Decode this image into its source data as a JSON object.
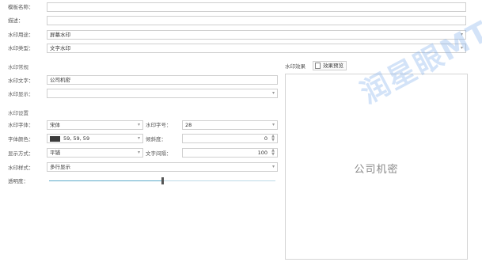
{
  "form": {
    "template_name": {
      "label": "模板名称：",
      "value": ""
    },
    "description": {
      "label": "描述：",
      "value": ""
    },
    "watermark_usage": {
      "label": "水印用途：",
      "value": "屏幕水印"
    },
    "watermark_type": {
      "label": "水印类型：",
      "value": "文字水印"
    }
  },
  "content_section": {
    "title": "水印常规",
    "text": {
      "label": "水印文字：",
      "value": "公司机密"
    },
    "display": {
      "label": "水印显示：",
      "value": ""
    }
  },
  "settings_section": {
    "title": "水印设置",
    "font": {
      "label": "水印字体：",
      "value": "宋体"
    },
    "font_size": {
      "label": "水印字号：",
      "value": "28"
    },
    "font_color": {
      "label": "字体颜色：",
      "value": "59, 59, 59",
      "swatch": "#3b3b3b"
    },
    "tilt": {
      "label": "倾斜度：",
      "value": "0"
    },
    "display_mode": {
      "label": "显示方式：",
      "value": "平铺"
    },
    "text_spacing": {
      "label": "文字间隔：",
      "value": "100"
    },
    "style": {
      "label": "水印样式：",
      "value": "多行显示"
    },
    "transparency": {
      "label": "透明度：",
      "value_fraction": 0.5
    }
  },
  "preview": {
    "label": "水印效果",
    "button_label": "效果预览",
    "sample_text": "公司机密"
  },
  "overlay_watermark": "润星眼MT系统",
  "colors": {
    "border": "#cfcfcf",
    "slider_track": "#5aa9c8",
    "thumb": "#555555"
  }
}
